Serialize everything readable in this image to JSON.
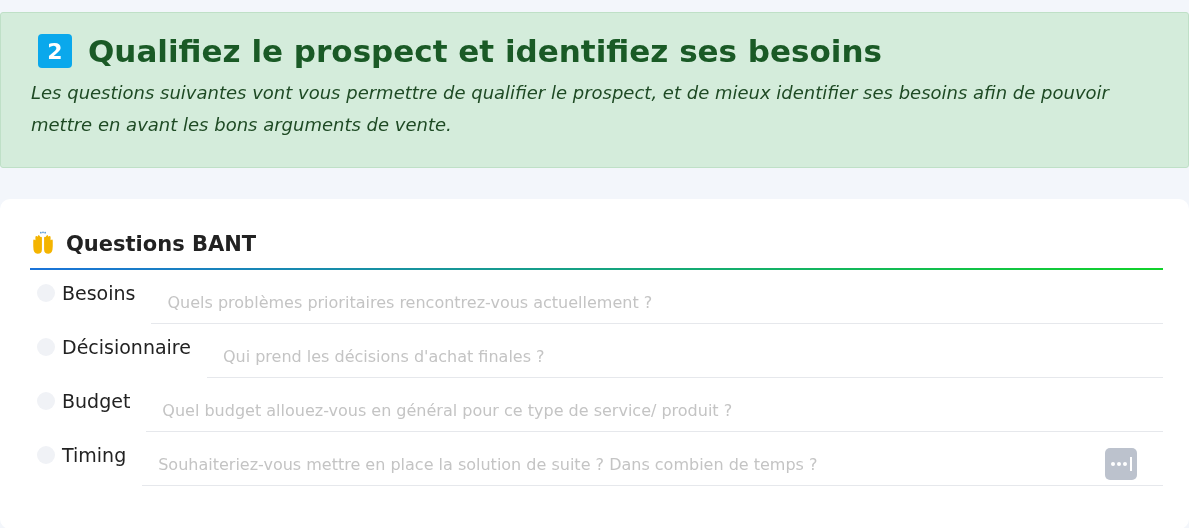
{
  "banner": {
    "step": "2",
    "title": "Qualifiez le prospect et identifiez ses besoins",
    "description": "Les questions suivantes vont vous permettre de qualifier le prospect, et de mieux identifier ses besoins afin de pouvoir mettre en avant les bons arguments de vente."
  },
  "section": {
    "title": "Questions BANT",
    "questions": [
      {
        "label": "Besoins",
        "placeholder": "Quels problèmes prioritaires rencontrez-vous actuellement ?",
        "checked": false,
        "kind": "text"
      },
      {
        "label": "Décisionnaire",
        "placeholder": "Qui prend les décisions d'achat finales ?",
        "checked": false,
        "kind": "text"
      },
      {
        "label": "Budget",
        "placeholder": "Quel budget allouez-vous en général pour ce type de service/ produit ?",
        "checked": false,
        "kind": "text"
      },
      {
        "label": "Timing",
        "placeholder": "Souhaiteriez-vous mettre en place la solution de suite ? Dans combien de temps ?",
        "checked": false,
        "kind": "text-with-autofill"
      }
    ]
  }
}
